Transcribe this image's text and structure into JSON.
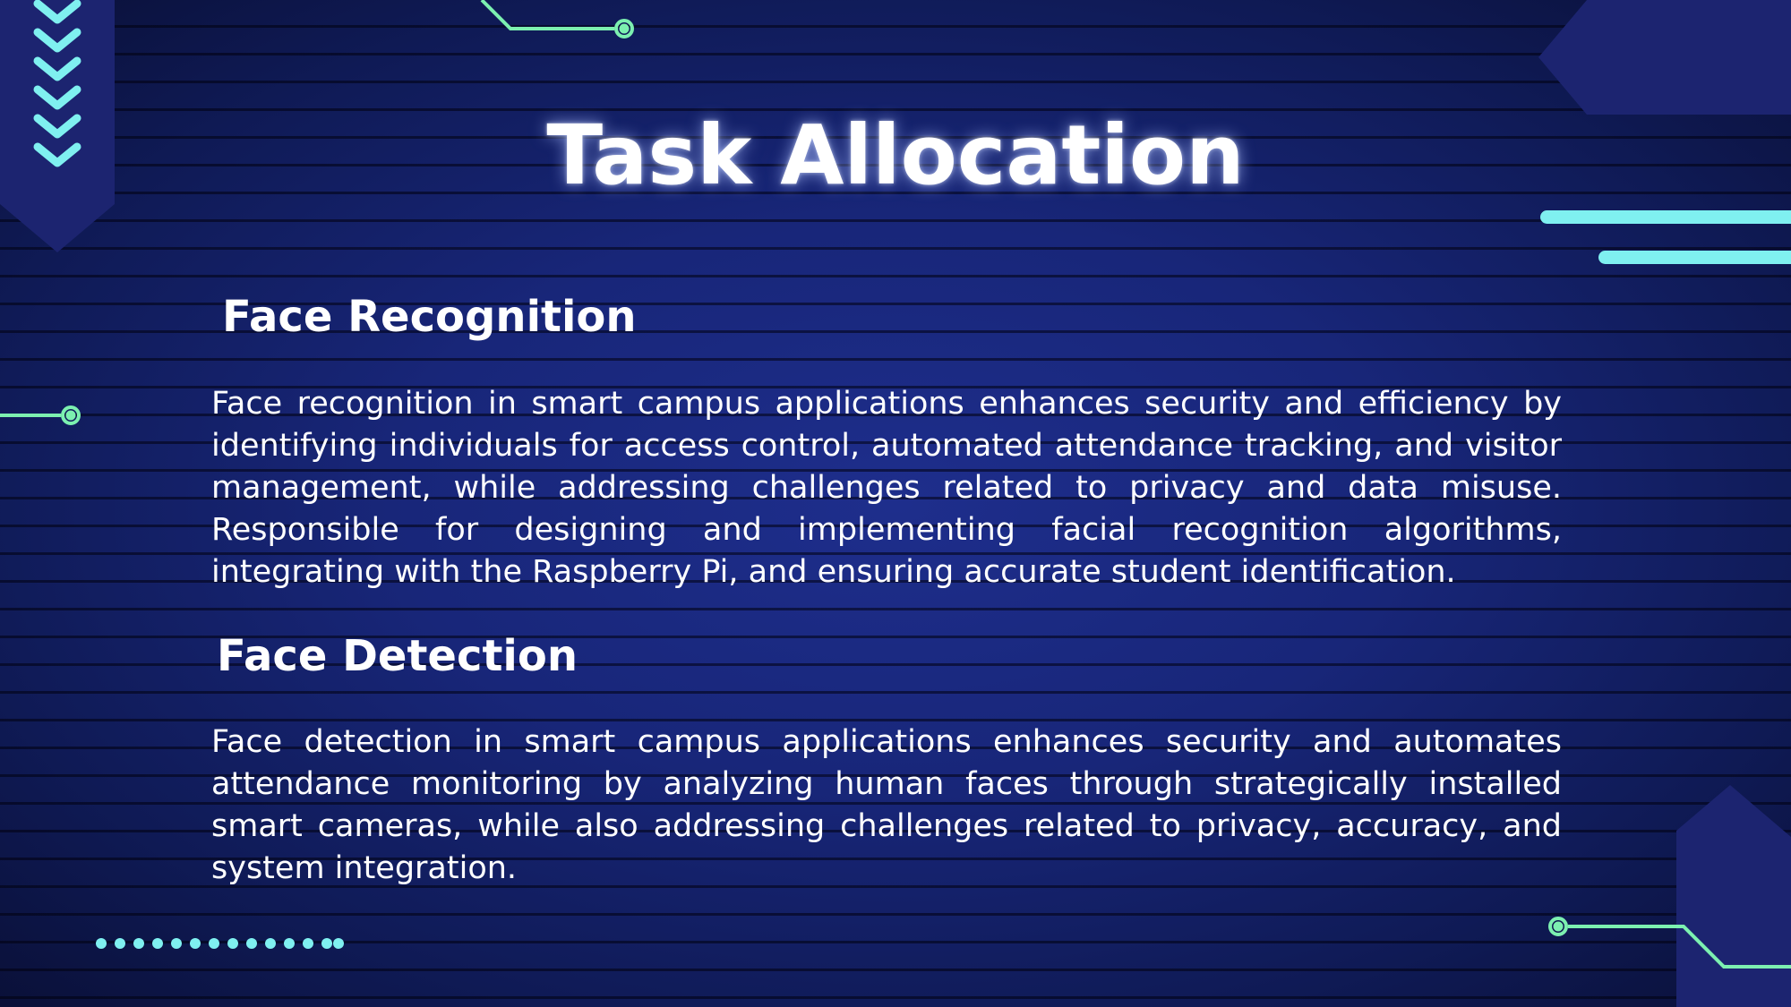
{
  "slide": {
    "title": "Task Allocation",
    "sections": [
      {
        "heading": "Face Recognition",
        "body": "Face recognition in smart campus applications enhances security and efficiency by identifying individuals for access control, automated attendance tracking, and visitor management, while addressing challenges related to privacy and data misuse. Responsible for designing and implementing facial recognition algorithms, integrating with the Raspberry Pi, and ensuring accurate student identification."
      },
      {
        "heading": "Face Detection",
        "body": "Face detection in smart campus applications enhances security and automates attendance monitoring by analyzing human faces through strategically installed smart cameras, while also addressing challenges related to privacy, accuracy, and system integration."
      }
    ]
  },
  "colors": {
    "accent_cyan": "#7ff0f0",
    "accent_green": "#7cf0b0",
    "panel_navy": "#1c2470",
    "text": "#ffffff"
  }
}
